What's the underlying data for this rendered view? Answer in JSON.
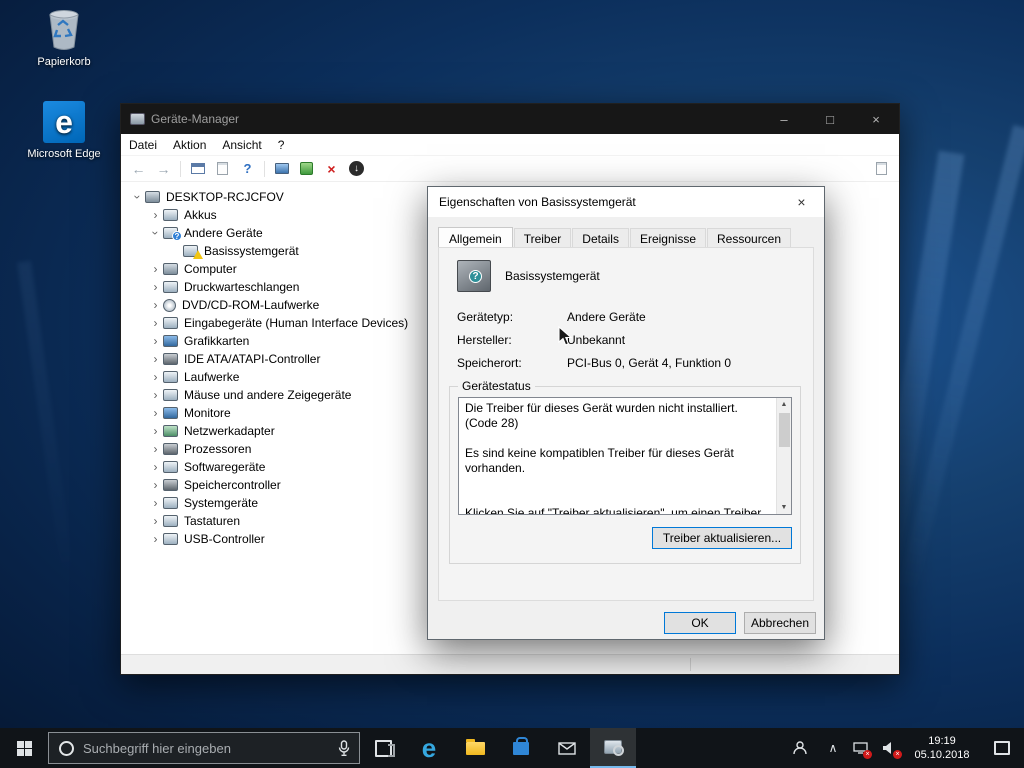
{
  "desktop": {
    "icons": [
      {
        "label": "Papierkorb"
      },
      {
        "label": "Microsoft Edge"
      }
    ]
  },
  "window": {
    "title": "Geräte-Manager",
    "menu": [
      "Datei",
      "Aktion",
      "Ansicht",
      "?"
    ],
    "tree": {
      "root": "DESKTOP-RCJCFOV",
      "items": [
        {
          "label": "Akkus",
          "icon": "battery-icon"
        },
        {
          "label": "Andere Geräte",
          "icon": "unknown-device-icon",
          "expanded": true
        },
        {
          "label": "Basissystemgerät",
          "icon": "unknown-device-warning-icon",
          "child": true
        },
        {
          "label": "Computer",
          "icon": "computer-icon"
        },
        {
          "label": "Druckwarteschlangen",
          "icon": "printer-icon"
        },
        {
          "label": "DVD/CD-ROM-Laufwerke",
          "icon": "disc-drive-icon"
        },
        {
          "label": "Eingabegeräte (Human Interface Devices)",
          "icon": "hid-icon"
        },
        {
          "label": "Grafikkarten",
          "icon": "display-adapter-icon"
        },
        {
          "label": "IDE ATA/ATAPI-Controller",
          "icon": "ata-controller-icon"
        },
        {
          "label": "Laufwerke",
          "icon": "disk-drive-icon"
        },
        {
          "label": "Mäuse und andere Zeigegeräte",
          "icon": "mouse-icon"
        },
        {
          "label": "Monitore",
          "icon": "monitor-icon"
        },
        {
          "label": "Netzwerkadapter",
          "icon": "network-adapter-icon"
        },
        {
          "label": "Prozessoren",
          "icon": "processor-icon"
        },
        {
          "label": "Softwaregeräte",
          "icon": "software-device-icon"
        },
        {
          "label": "Speichercontroller",
          "icon": "storage-controller-icon"
        },
        {
          "label": "Systemgeräte",
          "icon": "system-devices-icon"
        },
        {
          "label": "Tastaturen",
          "icon": "keyboard-icon"
        },
        {
          "label": "USB-Controller",
          "icon": "usb-controller-icon"
        }
      ]
    }
  },
  "dialog": {
    "title": "Eigenschaften von Basissystemgerät",
    "tabs": [
      "Allgemein",
      "Treiber",
      "Details",
      "Ereignisse",
      "Ressourcen"
    ],
    "device_name": "Basissystemgerät",
    "fields": [
      {
        "label": "Gerätetyp:",
        "value": "Andere Geräte"
      },
      {
        "label": "Hersteller:",
        "value": "Unbekannt"
      },
      {
        "label": "Speicherort:",
        "value": "PCI-Bus 0, Gerät 4, Funktion 0"
      }
    ],
    "status": {
      "group_label": "Gerätestatus",
      "lines": [
        "Die Treiber für dieses Gerät wurden nicht installiert. (Code 28)",
        "Es sind keine kompatiblen Treiber für dieses Gerät vorhanden.",
        "Klicken Sie auf \"Treiber aktualisieren\", um einen Treiber für dieses Gerät zu finden."
      ]
    },
    "buttons": {
      "update_driver": "Treiber aktualisieren...",
      "ok": "OK",
      "cancel": "Abbrechen"
    }
  },
  "taskbar": {
    "search_placeholder": "Suchbegriff hier eingeben",
    "clock": {
      "time": "19:19",
      "date": "05.10.2018"
    }
  },
  "icons": {
    "question": "?",
    "minimize": "–",
    "maximize": "□",
    "close": "×",
    "back": "←",
    "forward": "→",
    "help": "?",
    "chevron": "›",
    "down_arrow": "↓",
    "up_chevron": "∧",
    "edge_letter": "e",
    "scroll_up": "▲",
    "scroll_down": "▼",
    "red_x": "×"
  },
  "colors": {
    "accent": "#0078d7",
    "taskbar": "#101418",
    "warning": "#f2c511"
  }
}
